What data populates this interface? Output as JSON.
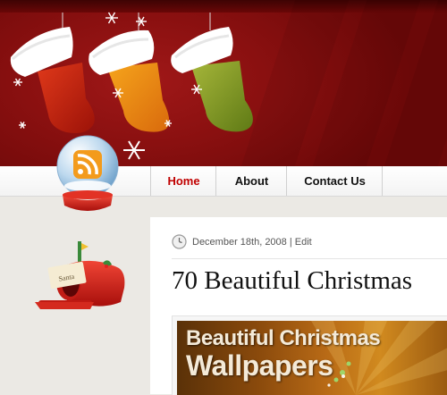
{
  "nav": {
    "items": [
      {
        "label": "Home",
        "active": true
      },
      {
        "label": "About",
        "active": false
      },
      {
        "label": "Contact Us",
        "active": false
      }
    ]
  },
  "post": {
    "date": "December 18th, 2008",
    "separator": "|",
    "edit_label": "Edit",
    "title": "70 Beautiful Christmas",
    "thumbnail": {
      "line1": "Beautiful Christmas",
      "line2": "Wallpapers"
    }
  },
  "mailbox_tag": "Santa",
  "icons": [
    "christmas-stocking-icon",
    "snowflake-icon",
    "rss-snow-globe-icon",
    "clock-icon",
    "santa-mailbox-icon"
  ],
  "colors": {
    "banner_red": "#8a1010",
    "nav_active": "#c00000",
    "page_bg": "#ebe9e4"
  }
}
